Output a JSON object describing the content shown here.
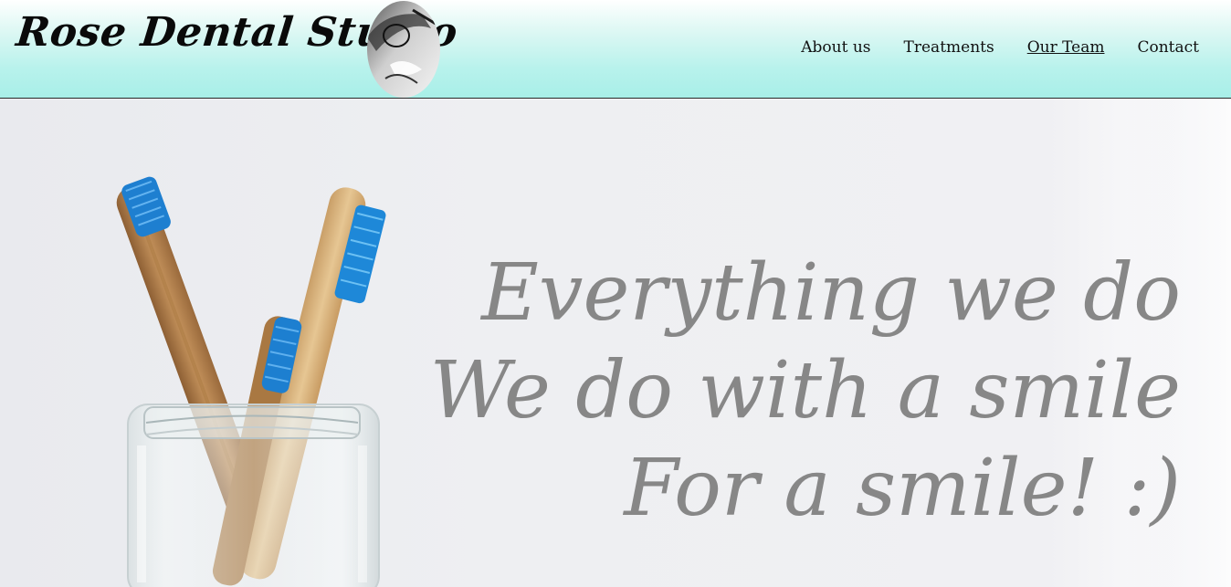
{
  "brand": {
    "name": "Rose Dental Studio",
    "logo_icon": "toothbrush-oval-logo-icon"
  },
  "nav": {
    "items": [
      {
        "label": "About us",
        "active": false
      },
      {
        "label": "Treatments",
        "active": false
      },
      {
        "label": "Our Team",
        "active": true
      },
      {
        "label": "Contact",
        "active": false
      }
    ]
  },
  "hero": {
    "image": "toothbrushes-in-glass-jar-photo",
    "slogan": {
      "line1": "Everything we do",
      "line2": "We do with a smile",
      "line3": "For a smile! :)"
    }
  },
  "colors": {
    "header_gradient_top": "#ffffff",
    "header_gradient_bottom": "#a8efe8",
    "slogan_text": "#878787",
    "toothbrush_bristles": "#1e88d8",
    "bamboo": "#b88a55"
  }
}
